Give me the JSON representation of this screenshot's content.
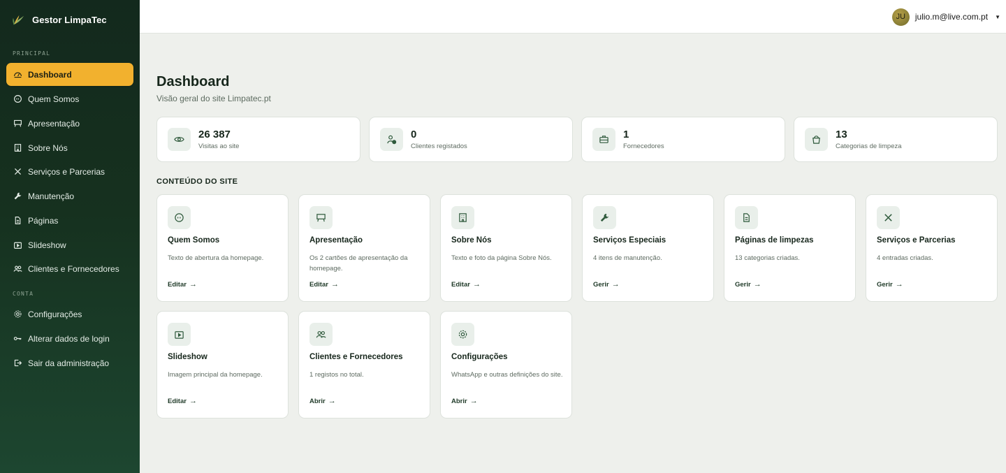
{
  "brand": {
    "name": "Gestor LimpaTec"
  },
  "sidebar": {
    "principal_label": "PRINCIPAL",
    "conta_label": "CONTA",
    "items": [
      {
        "label": "Dashboard",
        "icon": "gauge-icon",
        "active": true
      },
      {
        "label": "Quem Somos",
        "icon": "chat-quote-icon"
      },
      {
        "label": "Apresentação",
        "icon": "easel-icon"
      },
      {
        "label": "Sobre Nós",
        "icon": "building-icon"
      },
      {
        "label": "Serviços e Parcerias",
        "icon": "tools-icon"
      },
      {
        "label": "Manutenção",
        "icon": "wrench-icon"
      },
      {
        "label": "Páginas",
        "icon": "file-icon"
      },
      {
        "label": "Slideshow",
        "icon": "play-icon"
      },
      {
        "label": "Clientes e Fornecedores",
        "icon": "users-icon"
      }
    ],
    "account_items": [
      {
        "label": "Configurações",
        "icon": "gear-icon"
      },
      {
        "label": "Alterar dados de login",
        "icon": "key-icon"
      },
      {
        "label": "Sair da administração",
        "icon": "logout-icon"
      }
    ]
  },
  "topbar": {
    "avatar_initials": "JU",
    "email": "julio.m@live.com.pt",
    "caret": "▼"
  },
  "page": {
    "title": "Dashboard",
    "subtitle": "Visão geral do site Limpatec.pt"
  },
  "stats": [
    {
      "value": "26 387",
      "label": "Visitas ao site",
      "icon": "eye-icon"
    },
    {
      "value": "0",
      "label": "Clientes registados",
      "icon": "user-check-icon"
    },
    {
      "value": "1",
      "label": "Fornecedores",
      "icon": "briefcase-icon"
    },
    {
      "value": "13",
      "label": "Categorias de limpeza",
      "icon": "bucket-icon"
    }
  ],
  "content_section": {
    "heading": "CONTEÚDO DO SITE"
  },
  "cards": [
    {
      "title": "Quem Somos",
      "desc": "Texto de abertura da homepage.",
      "action": "Editar",
      "icon": "chat-quote-icon"
    },
    {
      "title": "Apresentação",
      "desc": "Os 2 cartões de apresentação da homepage.",
      "action": "Editar",
      "icon": "easel-icon"
    },
    {
      "title": "Sobre Nós",
      "desc": "Texto e foto da página Sobre Nós.",
      "action": "Editar",
      "icon": "building-icon"
    },
    {
      "title": "Serviços Especiais",
      "desc": "4 itens de manutenção.",
      "action": "Gerir",
      "icon": "wrench-icon"
    },
    {
      "title": "Páginas de limpezas",
      "desc": "13 categorias criadas.",
      "action": "Gerir",
      "icon": "file-icon"
    },
    {
      "title": "Serviços e Parcerias",
      "desc": "4 entradas criadas.",
      "action": "Gerir",
      "icon": "tools-icon"
    },
    {
      "title": "Slideshow",
      "desc": "Imagem principal da homepage.",
      "action": "Editar",
      "icon": "play-icon"
    },
    {
      "title": "Clientes e Fornecedores",
      "desc": "1 registos no total.",
      "action": "Abrir",
      "icon": "users-icon"
    },
    {
      "title": "Configurações",
      "desc": "WhatsApp e outras definições do site.",
      "action": "Abrir",
      "icon": "gear-icon"
    }
  ],
  "arrow": "→",
  "colors": {
    "accent": "#f2b12e",
    "sidebar_dark": "#13291d",
    "icon_green": "#2f5a3c",
    "page_bg": "#eef0ec"
  }
}
